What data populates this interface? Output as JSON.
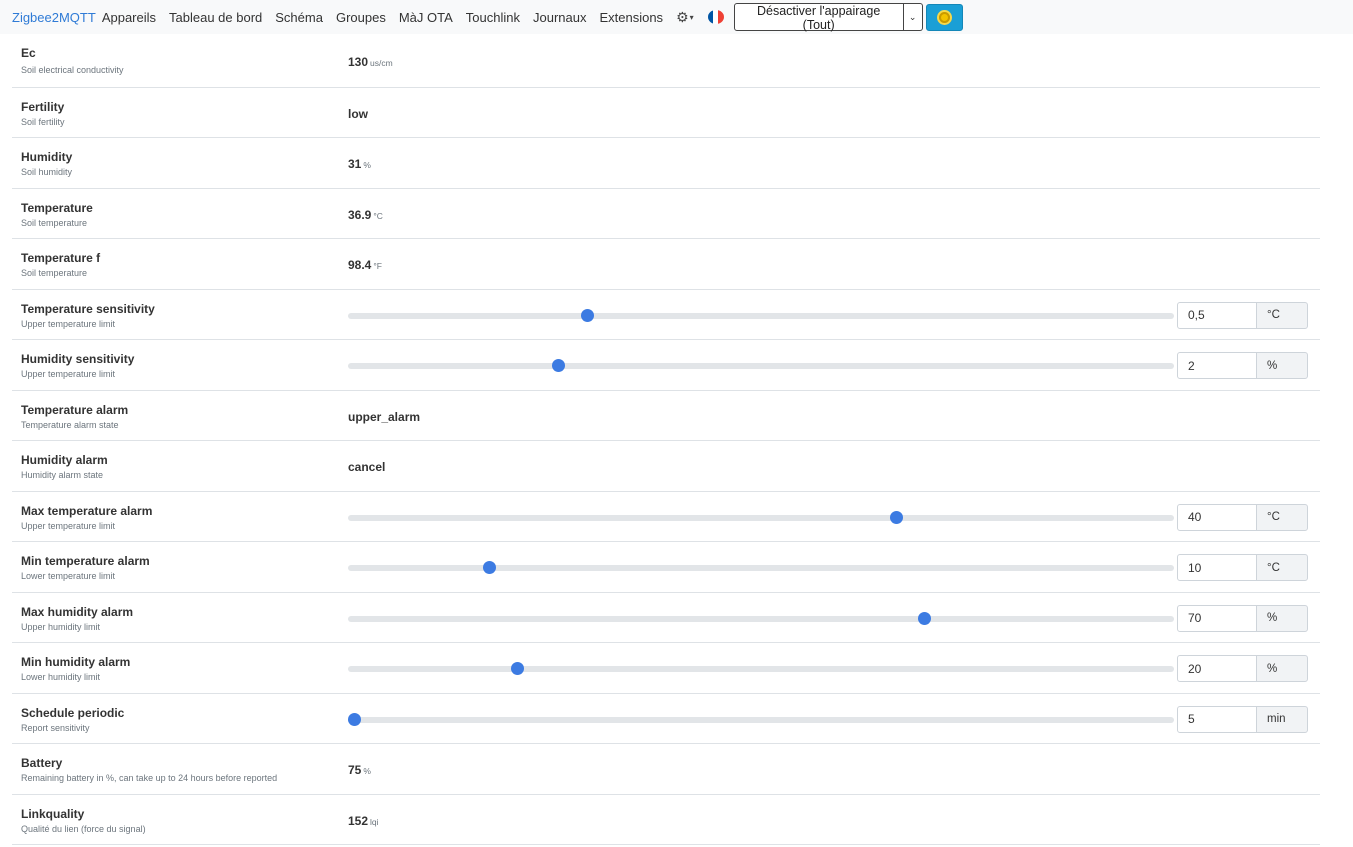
{
  "nav": {
    "brand": "Zigbee2MQTT",
    "links": [
      "Appareils",
      "Tableau de bord",
      "Schéma",
      "Groupes",
      "MàJ OTA",
      "Touchlink",
      "Journaux",
      "Extensions"
    ],
    "permit_join_label": "Désactiver l'appairage (Tout)",
    "settings_icon": "gear-icon",
    "language_icon": "french-flag-icon",
    "theme_icon": "sun-icon"
  },
  "rows": [
    {
      "name": "Ec",
      "desc": "Soil electrical conductivity",
      "type": "value",
      "value": "130",
      "unit": "us/cm"
    },
    {
      "name": "Fertility",
      "desc": "Soil fertility",
      "type": "value",
      "value": "low",
      "unit": ""
    },
    {
      "name": "Humidity",
      "desc": "Soil humidity",
      "type": "value",
      "value": "31",
      "unit": "%"
    },
    {
      "name": "Temperature",
      "desc": "Soil temperature",
      "type": "value",
      "value": "36.9",
      "unit": "°C"
    },
    {
      "name": "Temperature f",
      "desc": "Soil temperature",
      "type": "value",
      "value": "98.4",
      "unit": "°F"
    },
    {
      "name": "Temperature sensitivity",
      "desc": "Upper temperature limit",
      "type": "slider",
      "value": "0,5",
      "unit": "°C",
      "level": 0.289
    },
    {
      "name": "Humidity sensitivity",
      "desc": "Upper temperature limit",
      "type": "slider",
      "value": "2",
      "unit": "%",
      "level": 0.254
    },
    {
      "name": "Temperature alarm",
      "desc": "Temperature alarm state",
      "type": "value",
      "value": "upper_alarm",
      "unit": ""
    },
    {
      "name": "Humidity alarm",
      "desc": "Humidity alarm state",
      "type": "value",
      "value": "cancel",
      "unit": ""
    },
    {
      "name": "Max temperature alarm",
      "desc": "Upper temperature limit",
      "type": "slider",
      "value": "40",
      "unit": "°C",
      "level": 0.664
    },
    {
      "name": "Min temperature alarm",
      "desc": "Lower temperature limit",
      "type": "slider",
      "value": "10",
      "unit": "°C",
      "level": 0.171
    },
    {
      "name": "Max humidity alarm",
      "desc": "Upper humidity limit",
      "type": "slider",
      "value": "70",
      "unit": "%",
      "level": 0.697
    },
    {
      "name": "Min humidity alarm",
      "desc": "Lower humidity limit",
      "type": "slider",
      "value": "20",
      "unit": "%",
      "level": 0.204
    },
    {
      "name": "Schedule periodic",
      "desc": "Report sensitivity",
      "type": "slider",
      "value": "5",
      "unit": "min",
      "level": 0.007
    },
    {
      "name": "Battery",
      "desc": "Remaining battery in %, can take up to 24 hours before reported",
      "type": "value",
      "value": "75",
      "unit": "%"
    },
    {
      "name": "Linkquality",
      "desc": "Qualité du lien (force du signal)",
      "type": "value",
      "value": "152",
      "unit": "lqi"
    }
  ]
}
